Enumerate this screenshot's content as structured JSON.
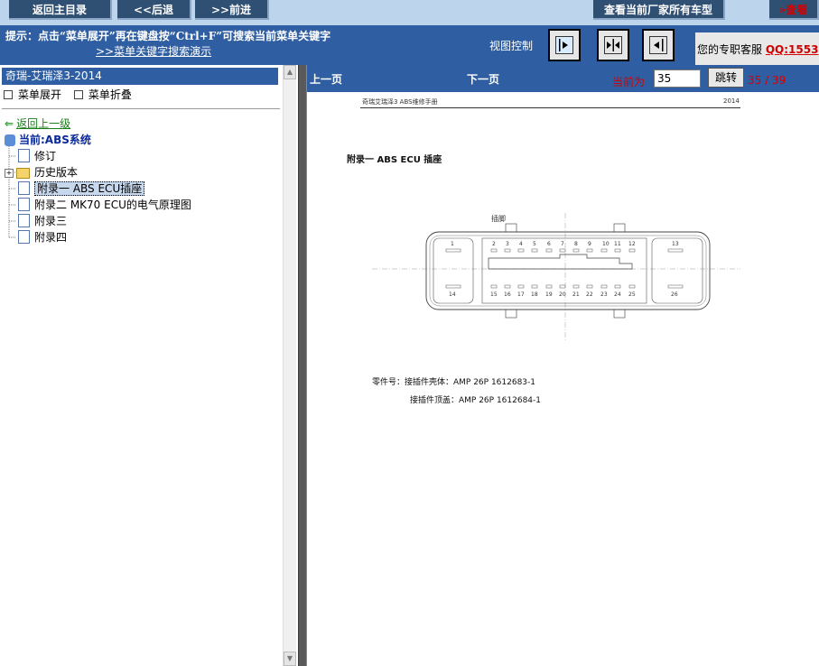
{
  "toolbar": {
    "home_label": "返回主目录",
    "back_label": "<<后退",
    "forward_label": ">>前进",
    "all_models_label": "查看当前厂家所有车型",
    "view_label": "»查看"
  },
  "hint": {
    "text": "提示：点击“菜单展开”再在键盘按“Ctrl+F”可搜索当前菜单关键字",
    "demo_link": ">>菜单关键字搜索演示"
  },
  "view_control": {
    "label": "视图控制"
  },
  "service": {
    "label": "您的专职客服",
    "qq": "QQ:1553"
  },
  "tree": {
    "title": "奇瑞-艾瑞泽3-2014",
    "expand_label": "菜单展开",
    "collapse_label": "菜单折叠",
    "back_label": "返回上一级",
    "current_label": "当前:ABS系统",
    "items": [
      {
        "label": "修订"
      },
      {
        "label": "历史版本"
      },
      {
        "label": "附录一  ABS ECU插座"
      },
      {
        "label": "附录二  MK70 ECU的电气原理图"
      },
      {
        "label": "附录三"
      },
      {
        "label": "附录四"
      }
    ]
  },
  "nav": {
    "prev_label": "上一页",
    "next_label": "下一页",
    "current_label": "当前为",
    "page_value": "35",
    "jump_label": "跳转",
    "page_count": "35 / 39"
  },
  "doc": {
    "header_left": "奇瑞艾瑞泽3  ABS维修手册",
    "header_right": "2014",
    "title": "附录一    ABS ECU 插座",
    "connector_label": "插脚",
    "pins_top_left": "1",
    "pins_top_mid": [
      "2",
      "3",
      "4",
      "5",
      "6",
      "7",
      "8",
      "9",
      "10",
      "11",
      "12"
    ],
    "pins_top_right": "13",
    "pins_bottom_left": "14",
    "pins_bottom_mid": [
      "15",
      "16",
      "17",
      "18",
      "19",
      "20",
      "21",
      "22",
      "23",
      "24",
      "25"
    ],
    "pins_bottom_right": "26",
    "part_line1": "零件号：接插件壳体：AMP 26P 1612683-1",
    "part_line2": "接插件顶盖：AMP 26P 1612684-1"
  }
}
